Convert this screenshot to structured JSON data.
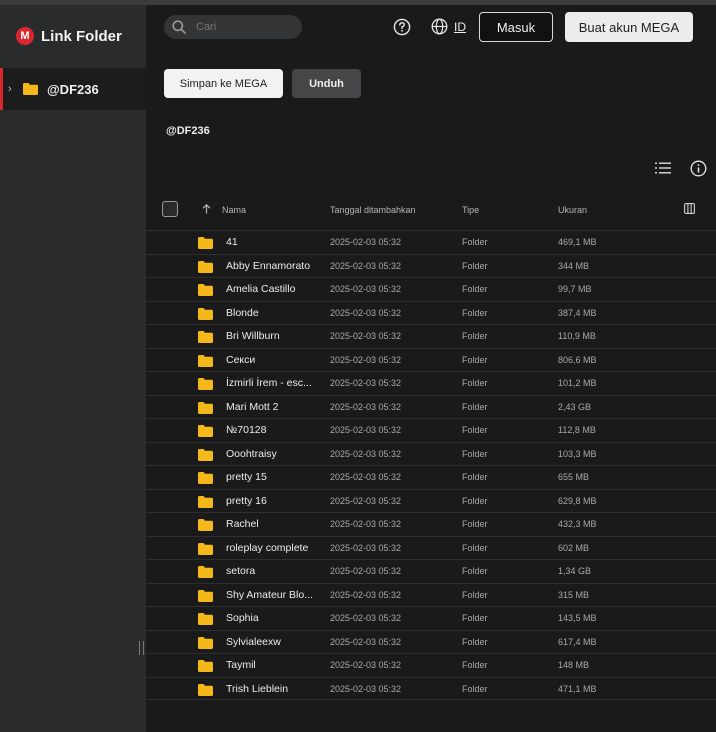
{
  "app": {
    "logo_letter": "M",
    "logo_text": "Link Folder"
  },
  "sidebar": {
    "folder": "@DF236"
  },
  "header": {
    "search_placeholder": "Cari",
    "lang": "ID",
    "login": "Masuk",
    "signup": "Buat akun MEGA"
  },
  "actions": {
    "save": "Simpan ke MEGA",
    "download": "Unduh"
  },
  "folder_title": "@DF236",
  "table": {
    "headers": {
      "name": "Nama",
      "date": "Tanggal ditambahkan",
      "type": "Tipe",
      "size": "Ukuran"
    },
    "rows": [
      {
        "name": "41",
        "date": "2025-02-03 05:32",
        "type": "Folder",
        "size": "469,1 MB"
      },
      {
        "name": "Abby Ennamorato",
        "date": "2025-02-03 05:32",
        "type": "Folder",
        "size": "344 MB"
      },
      {
        "name": "Amelia Castillo",
        "date": "2025-02-03 05:32",
        "type": "Folder",
        "size": "99,7 MB"
      },
      {
        "name": "Blonde",
        "date": "2025-02-03 05:32",
        "type": "Folder",
        "size": "387,4 MB"
      },
      {
        "name": "Bri Willburn",
        "date": "2025-02-03 05:32",
        "type": "Folder",
        "size": "110,9 MB"
      },
      {
        "name": "Секси",
        "date": "2025-02-03 05:32",
        "type": "Folder",
        "size": "806,6 MB"
      },
      {
        "name": "İzmirli İrem - esc...",
        "date": "2025-02-03 05:32",
        "type": "Folder",
        "size": "101,2 MB"
      },
      {
        "name": "Mari Mott 2",
        "date": "2025-02-03 05:32",
        "type": "Folder",
        "size": "2,43 GB"
      },
      {
        "name": "№70128",
        "date": "2025-02-03 05:32",
        "type": "Folder",
        "size": "112,8 MB"
      },
      {
        "name": "Ooohtraisy",
        "date": "2025-02-03 05:32",
        "type": "Folder",
        "size": "103,3 MB"
      },
      {
        "name": "pretty 15",
        "date": "2025-02-03 05:32",
        "type": "Folder",
        "size": "655 MB"
      },
      {
        "name": "pretty 16",
        "date": "2025-02-03 05:32",
        "type": "Folder",
        "size": "629,8 MB"
      },
      {
        "name": "Rachel",
        "date": "2025-02-03 05:32",
        "type": "Folder",
        "size": "432,3 MB"
      },
      {
        "name": "roleplay complete",
        "date": "2025-02-03 05:32",
        "type": "Folder",
        "size": "602 MB"
      },
      {
        "name": "setora",
        "date": "2025-02-03 05:32",
        "type": "Folder",
        "size": "1,34 GB"
      },
      {
        "name": "Shy Amateur Blo...",
        "date": "2025-02-03 05:32",
        "type": "Folder",
        "size": "315 MB"
      },
      {
        "name": "Sophia",
        "date": "2025-02-03 05:32",
        "type": "Folder",
        "size": "143,5 MB"
      },
      {
        "name": "Sylvialeexw",
        "date": "2025-02-03 05:32",
        "type": "Folder",
        "size": "617,4 MB"
      },
      {
        "name": "Taymil",
        "date": "2025-02-03 05:32",
        "type": "Folder",
        "size": "148 MB"
      },
      {
        "name": "Trish Lieblein",
        "date": "2025-02-03 05:32",
        "type": "Folder",
        "size": "471,1 MB"
      }
    ]
  },
  "colors": {
    "brand": "#d9272e",
    "folder": "#f5b81b",
    "background": "#1a1a1a",
    "sidebar": "#2a2b2c"
  },
  "icons": [
    "mega-logo",
    "search-icon",
    "help-icon",
    "globe-icon",
    "folder-icon",
    "sort-up-icon",
    "list-view-icon",
    "info-icon",
    "columns-icon"
  ]
}
